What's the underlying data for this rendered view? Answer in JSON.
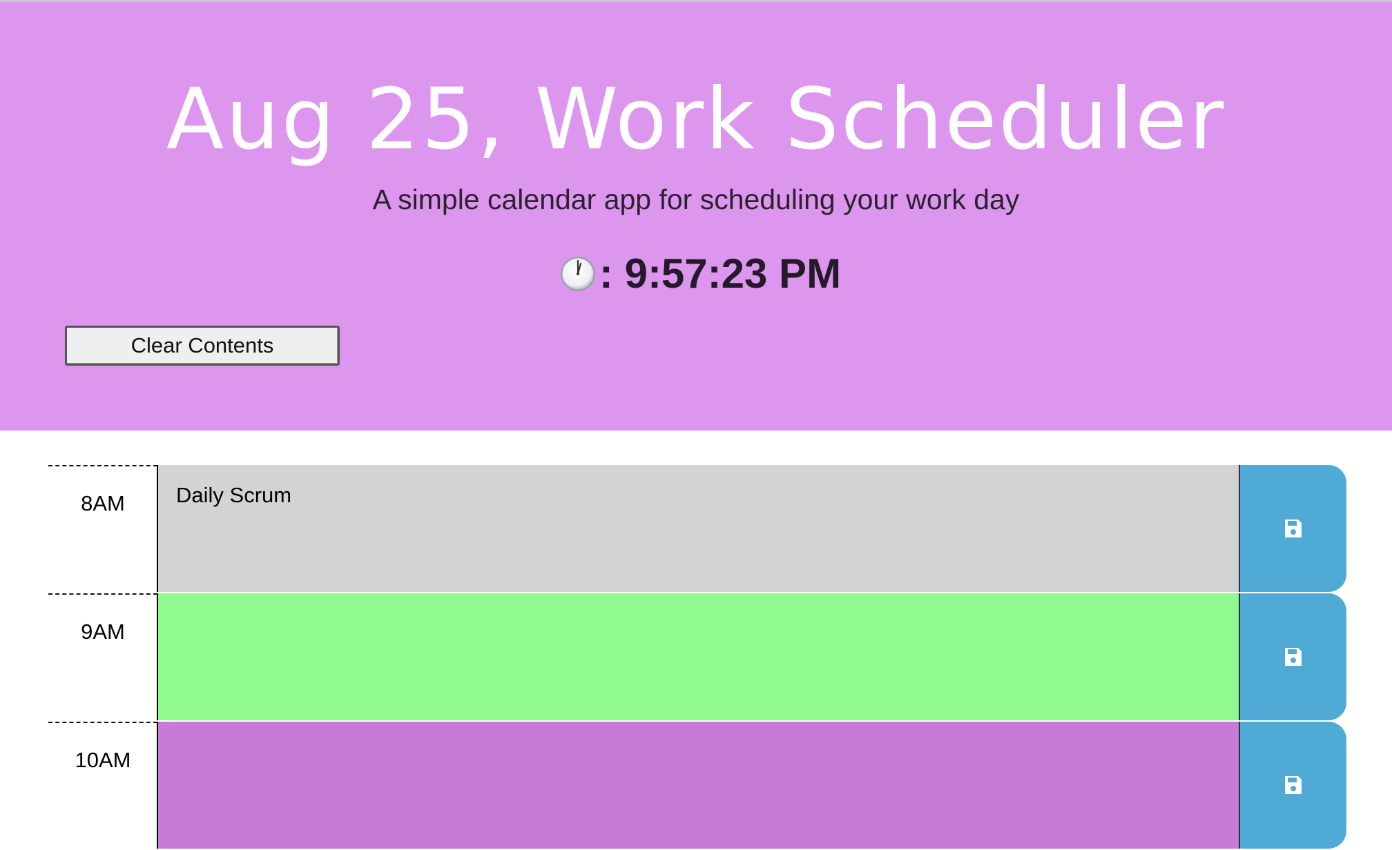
{
  "header": {
    "title": "Aug 25, Work Scheduler",
    "subtitle": "A simple calendar app for scheduling your work day",
    "clock_icon": "clock-face-icon",
    "clock_text": ": 9:57:23 PM",
    "clear_label": "Clear Contents",
    "background_color": "#dd96ee"
  },
  "schedule": {
    "save_icon": "floppy-disk-icon",
    "save_color": "#4fabd6",
    "rows": [
      {
        "hour": "8AM",
        "text": "Daily Scrum",
        "status": "past",
        "color": "#d3d3d3"
      },
      {
        "hour": "9AM",
        "text": "",
        "status": "present",
        "color": "#90fa90"
      },
      {
        "hour": "10AM",
        "text": "",
        "status": "future",
        "color": "#c77ad6"
      }
    ]
  }
}
